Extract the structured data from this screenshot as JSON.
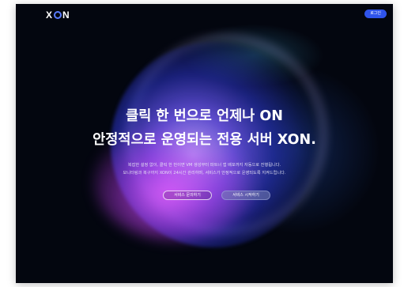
{
  "header": {
    "logo_text": "XON",
    "logo_parts": {
      "left": "X",
      "right": "N"
    },
    "login_label": "로그인"
  },
  "hero": {
    "headline_line1": "클릭 한 번으로 언제나 ON",
    "headline_line2": "안정적으로 운영되는 전용 서버 XON.",
    "subtext_line1": "복잡한 설정 없이, 클릭 한 번이면 VM 생성부터 파트너 앱 배포까지 자동으로 진행됩니다.",
    "subtext_line2": "모니터링과 복구까지 XON이 24시간 관리하며, 서비스가 안정적으로 운영되도록 지켜드립니다.",
    "cta_inquiry_label": "서비스 문의하기",
    "cta_start_label": "서비스 시작하기"
  },
  "colors": {
    "background": "#03060f",
    "accent": "#2f54eb",
    "glow_purple": "#7b5cff",
    "glow_pink": "#e05cff"
  },
  "icons": {
    "logo_o": "ring-o-icon"
  }
}
